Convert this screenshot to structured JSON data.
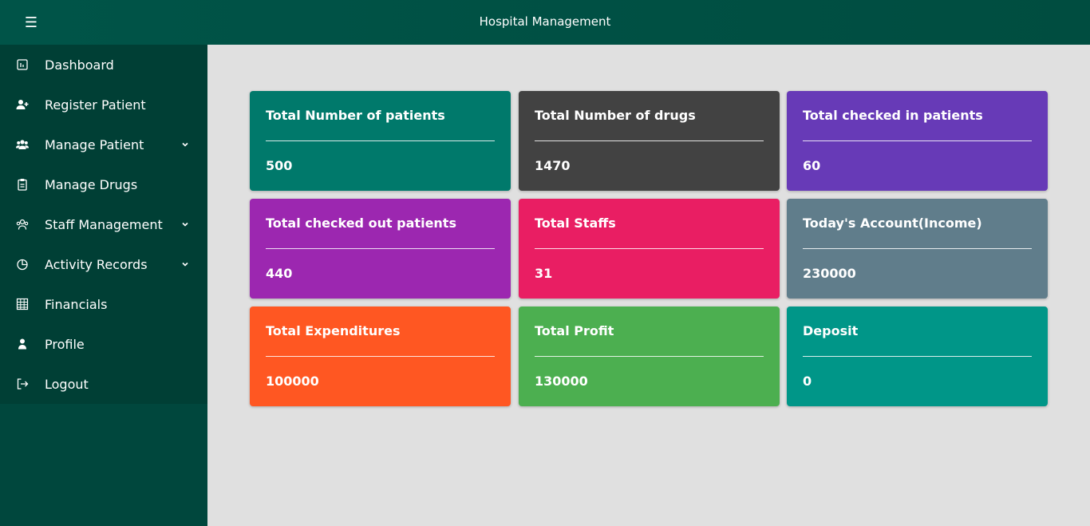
{
  "header": {
    "title": "Hospital Management",
    "menu_icon": "hamburger-icon",
    "menu_glyph": "☰"
  },
  "sidebar": {
    "items": [
      {
        "label": "Dashboard",
        "icon": "dashboard-icon"
      },
      {
        "label": "Register Patient",
        "icon": "user-plus-icon"
      },
      {
        "label": "Manage Patient",
        "icon": "users-icon",
        "has_submenu": true
      },
      {
        "label": "Manage Drugs",
        "icon": "clipboard-icon"
      },
      {
        "label": "Staff Management",
        "icon": "staff-icon",
        "has_submenu": true
      },
      {
        "label": "Activity Records",
        "icon": "pie-chart-icon",
        "has_submenu": true
      },
      {
        "label": "Financials",
        "icon": "table-icon"
      },
      {
        "label": "Profile",
        "icon": "user-icon"
      },
      {
        "label": "Logout",
        "icon": "logout-icon"
      }
    ]
  },
  "cards": [
    {
      "title": "Total Number of patients",
      "value": "500",
      "color": "#00796b"
    },
    {
      "title": "Total Number of drugs",
      "value": "1470",
      "color": "#424242"
    },
    {
      "title": "Total checked in patients",
      "value": "60",
      "color": "#673ab7"
    },
    {
      "title": "Total checked out patients",
      "value": "440",
      "color": "#9c27b0"
    },
    {
      "title": "Total Staffs",
      "value": "31",
      "color": "#e91e63"
    },
    {
      "title": "Today's Account(Income)",
      "value": "230000",
      "color": "#607d8b"
    },
    {
      "title": "Total Expenditures",
      "value": "100000",
      "color": "#ff5722"
    },
    {
      "title": "Total Profit",
      "value": "130000",
      "color": "#4caf50"
    },
    {
      "title": "Deposit",
      "value": "0",
      "color": "#009688"
    }
  ],
  "colors": {
    "header_bg": "#004d40",
    "sidebar_bg": "#00473d",
    "sidebar_list_bg": "#003f35",
    "main_bg": "#e0e0e0"
  }
}
